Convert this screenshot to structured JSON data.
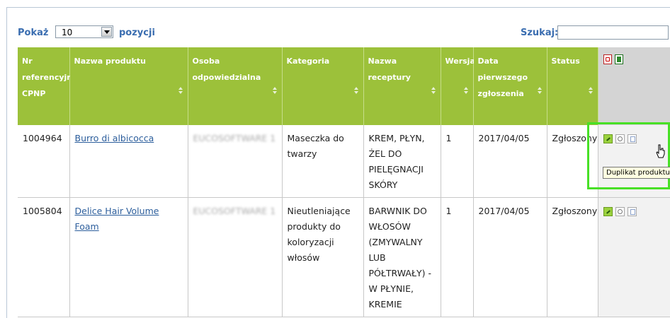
{
  "controls": {
    "show_label": "Pokaż",
    "page_size": "10",
    "positions_label": "pozycji",
    "search_label": "Szukaj:",
    "search_value": ""
  },
  "table": {
    "headers": [
      "Nr referencyjny CPNP",
      "Nazwa produktu",
      "Osoba odpowiedzialna",
      "Kategoria",
      "Nazwa receptury",
      "Wersja",
      "Data pierwszego zgłoszenia",
      "Status"
    ],
    "rows": [
      {
        "ref": "1004964",
        "product": "Burro di albicocca",
        "person": "EUCOSOFTWARE 1",
        "category": "Maseczka do twarzy",
        "recipe": "KREM, PŁYN, ŻEL DO PIELĘGNACJI SKÓRY",
        "version": "1",
        "date": "2017/04/05",
        "status": "Zgłoszony"
      },
      {
        "ref": "1005804",
        "product": "Delice Hair Volume Foam",
        "person": "EUCOSOFTWARE 1",
        "category": "Nieutleniające produkty do koloryzacji włosów",
        "recipe": "BARWNIK DO WŁOSÓW (ZMYWALNY LUB PÓŁTRWAŁY) - W PŁYNIE, KREMIE",
        "version": "1",
        "date": "2017/04/05",
        "status": "Zgłoszony"
      }
    ]
  },
  "tooltip": "Duplikat produktu",
  "icons": {
    "export_pdf": "pdf-icon",
    "export_xls": "excel-icon",
    "edit": "pencil-icon",
    "view": "magnifier-icon",
    "duplicate": "copy-icon",
    "cursor": "hand-pointer-icon"
  },
  "colors": {
    "header_bg": "#9cc13a",
    "link": "#2c5e9c",
    "highlight": "#48e026",
    "label": "#3a6db0"
  }
}
